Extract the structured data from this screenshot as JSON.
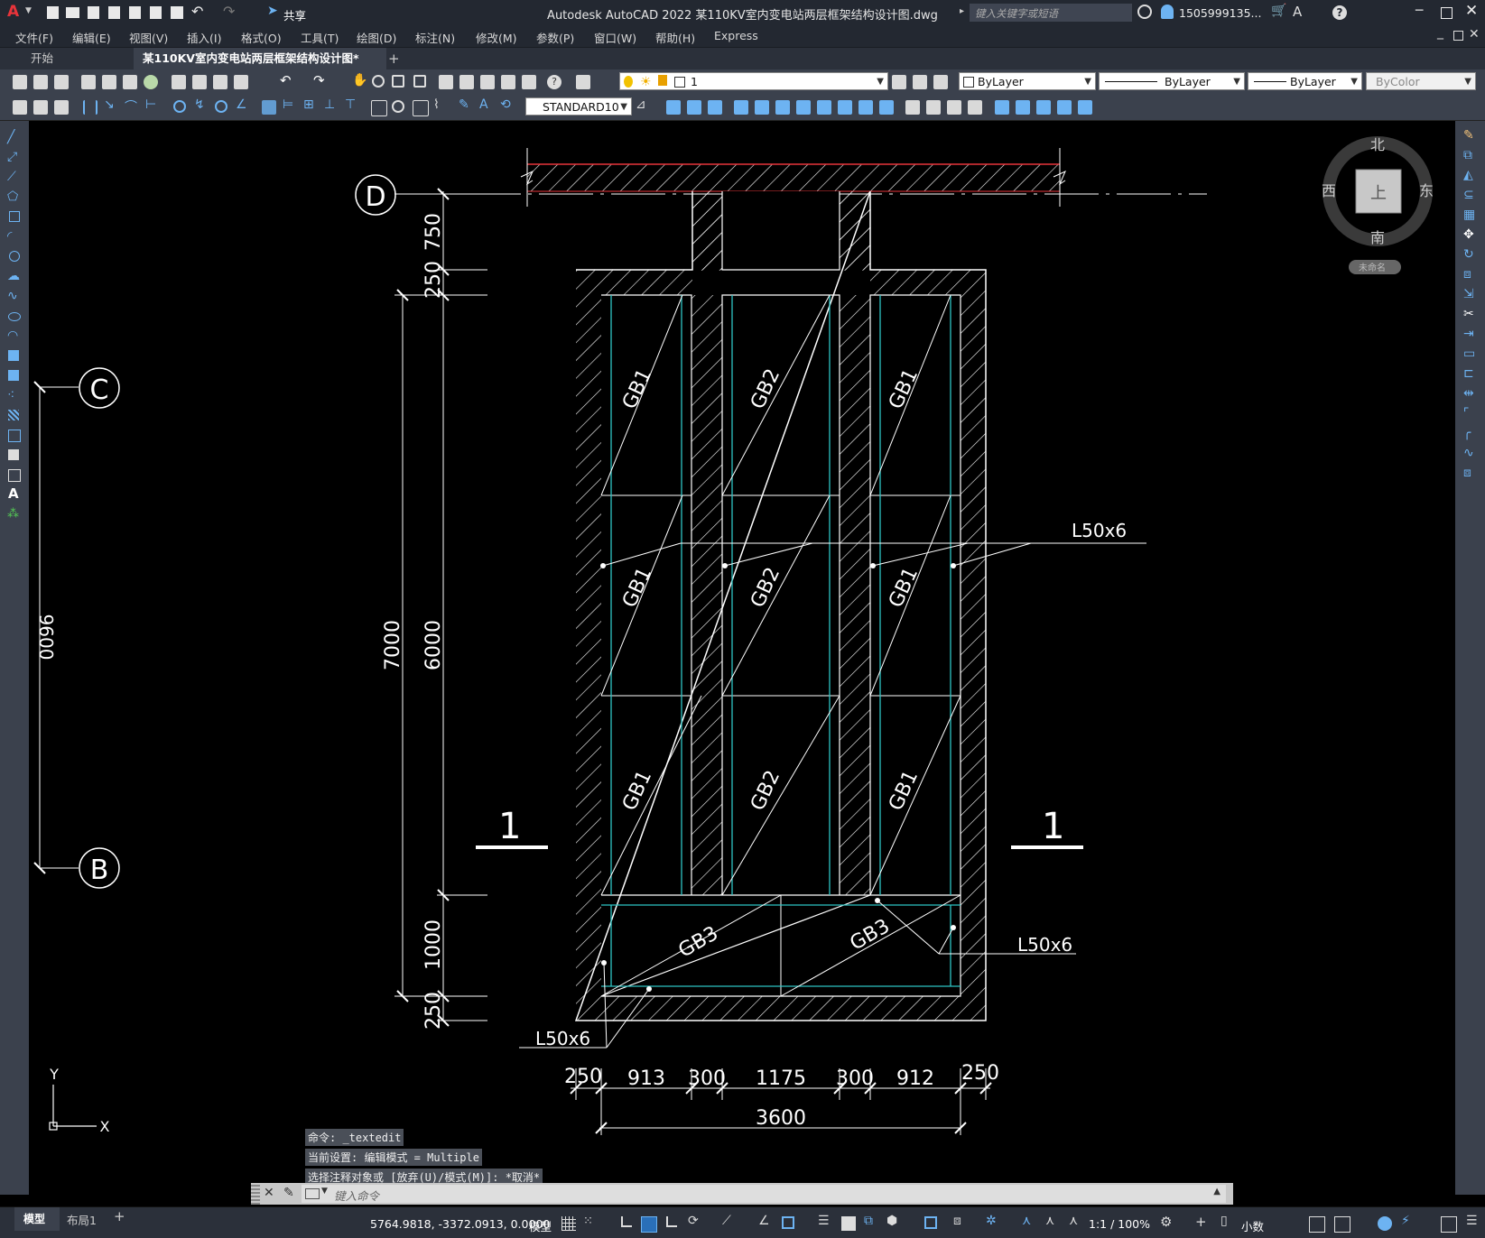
{
  "app": {
    "logo": "A",
    "title": "Autodesk AutoCAD 2022    某110KV室内变电站两层框架结构设计图.dwg",
    "search_placeholder": "键入关键字或短语",
    "user": "1505999135...",
    "share": "共享"
  },
  "menu": [
    "文件(F)",
    "编辑(E)",
    "视图(V)",
    "插入(I)",
    "格式(O)",
    "工具(T)",
    "绘图(D)",
    "标注(N)",
    "修改(M)",
    "参数(P)",
    "窗口(W)",
    "帮助(H)",
    "Express"
  ],
  "tabs": {
    "start": "开始",
    "active": "某110KV室内变电站两层框架结构设计图*",
    "add": "+"
  },
  "props": {
    "layer": "1",
    "color": "ByLayer",
    "linetype": "ByLayer",
    "lineweight": "ByLayer",
    "plotstyle": "ByColor",
    "dimstyle": "STANDARD10"
  },
  "viewcube": {
    "north": "北",
    "south": "南",
    "east": "东",
    "west": "西",
    "top": "上",
    "ucs": "未命名"
  },
  "drawing": {
    "grid_d": "D",
    "grid_c": "C",
    "grid_b": "B",
    "dim_750": "750",
    "dim_250a": "250",
    "dim_7000": "7000",
    "dim_6000": "6000",
    "dim_1000": "1000",
    "dim_250b": "250",
    "dim_left": "9600",
    "gb1": "GB1",
    "gb2": "GB2",
    "gb3": "GB3",
    "angle": "L50x6",
    "sec_left": "1",
    "sec_right": "1",
    "bottom_dims": [
      "250",
      "913",
      "300",
      "1175",
      "300",
      "912",
      "250"
    ],
    "total": "3600",
    "ucs_y": "Y",
    "ucs_x": "X"
  },
  "command": {
    "history": [
      "命令: _textedit",
      "当前设置: 编辑模式 = Multiple",
      "选择注释对象或 [放弃(U)/模式(M)]: *取消*"
    ],
    "placeholder": "键入命令"
  },
  "status": {
    "model_tab": "模型",
    "layout1": "布局1",
    "add": "+",
    "coords": "5764.9818, -3372.0913, 0.0000",
    "space": "模型",
    "scale": "1:1 / 100%",
    "units": "小数"
  }
}
